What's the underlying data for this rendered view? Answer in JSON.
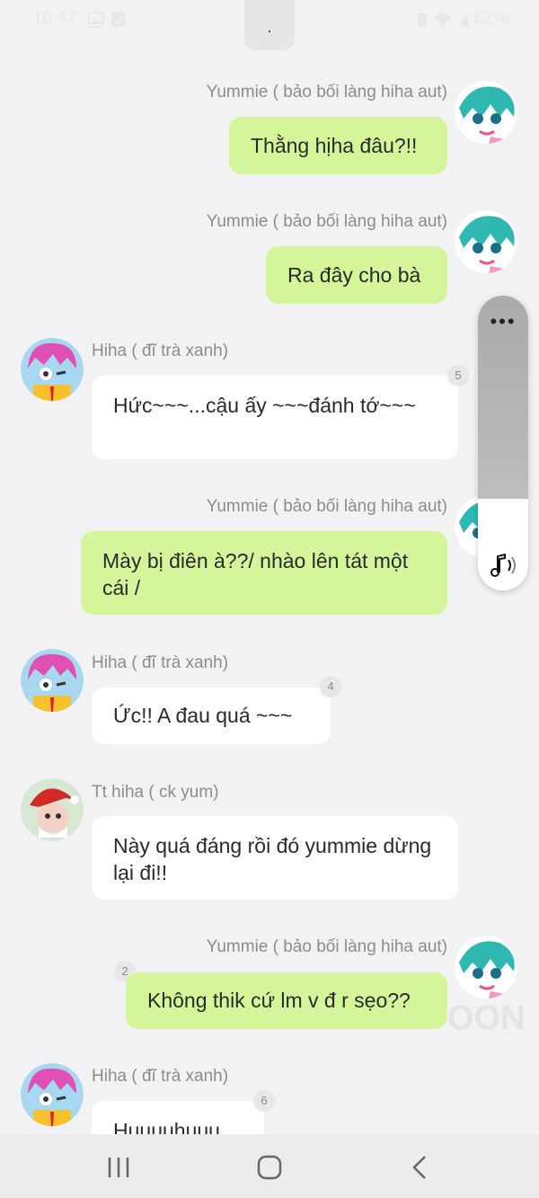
{
  "status_bar": {
    "time": "10:47",
    "battery": "62%"
  },
  "colors": {
    "outgoing_bubble": "#d5f59a",
    "incoming_bubble": "#ffffff",
    "background": "#f2f2f4"
  },
  "messages": [
    {
      "sender": "Yummie ( bảo bối làng hiha aut)",
      "text": "Thằng hịha đâu?!!",
      "direction": "out"
    },
    {
      "sender": "Yummie ( bảo bối làng hiha aut)",
      "text": "Ra đây cho bà",
      "direction": "out"
    },
    {
      "sender": "Hiha ( đĩ trà xanh)",
      "text": "Hức~~~...cậu ấy ~~~đánh tớ~~~",
      "direction": "in",
      "count": "5"
    },
    {
      "sender": "Yummie ( bảo bối làng hiha aut)",
      "text": "Mày bị điên à??/ nhào lên tát một cái /",
      "direction": "out"
    },
    {
      "sender": "Hiha ( đĩ trà xanh)",
      "text": "Ức!! A đau quá ~~~",
      "direction": "in",
      "count": "4"
    },
    {
      "sender": "Tt hiha ( ck yum)",
      "text": "Này quá đáng rồi đó yummie dừng lại đi!!",
      "direction": "in"
    },
    {
      "sender": "Yummie ( bảo bối làng hiha aut)",
      "text": "Không thik cứ lm v đ r sẹo??",
      "direction": "out",
      "count": "2"
    },
    {
      "sender": "Hiha ( đĩ trà xanh)",
      "text": "Huuuuhuuu",
      "direction": "in",
      "count": "6"
    }
  ],
  "volume_panel": {
    "more_label": "•••",
    "level_fraction": 0.31
  },
  "watermark": "OON"
}
